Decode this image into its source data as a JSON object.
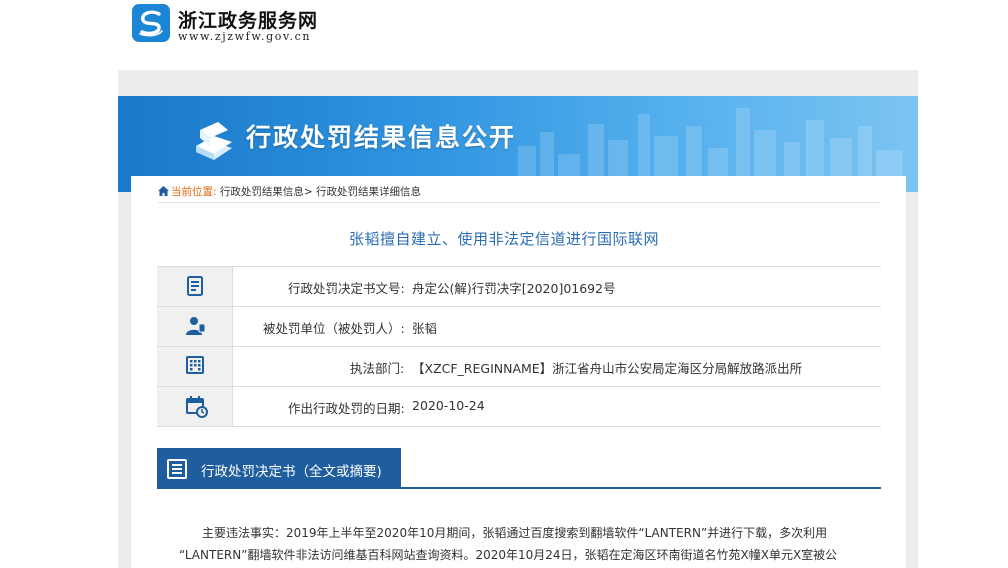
{
  "site": {
    "name": "浙江政务服务网",
    "url": "www.zjzwfw.gov.cn"
  },
  "banner": {
    "title": "行政处罚结果信息公开"
  },
  "breadcrumb": {
    "home": "当前位置:",
    "crumb1": "行政处罚结果信息>",
    "crumb2": "行政处罚结果详细信息"
  },
  "case": {
    "title": "张韬擅自建立、使用非法定信道进行国际联网"
  },
  "info": {
    "doc_no_label": "行政处罚决定书文号:",
    "doc_no_value": "舟定公(解)行罚决字[2020]01692号",
    "party_label": "被处罚单位（被处罚人）:",
    "party_value": "张韬",
    "dept_label": "执法部门:",
    "dept_value": "【XZCF_REGINNAME】浙江省舟山市公安局定海区分局解放路派出所",
    "date_label": "作出行政处罚的日期:",
    "date_value": "2020-10-24"
  },
  "decision": {
    "section_title": "行政处罚决定书（全文或摘要)",
    "line1": "主要违法事实：2019年上半年至2020年10月期间，张韬通过百度搜索到翻墙软件“LANTERN”并进行下载，多次利用",
    "line2": "“LANTERN”翻墙软件非法访问维基百科网站查询资料。2020年10月24日，张韬在定海区环南街道名竹苑X幢X单元X室被公"
  },
  "icons": {
    "logo": "zjzwfw-logo-icon",
    "book": "book-icon",
    "home": "home-icon",
    "document": "document-icon",
    "person": "person-icon",
    "building": "building-icon",
    "calendar": "calendar-icon",
    "list": "list-doc-icon"
  },
  "colors": {
    "banner_blue": "#1a78c8",
    "title_blue": "#2a6db5",
    "section_blue": "#1f5e9e",
    "breadcrumb_orange": "#e06a10"
  }
}
